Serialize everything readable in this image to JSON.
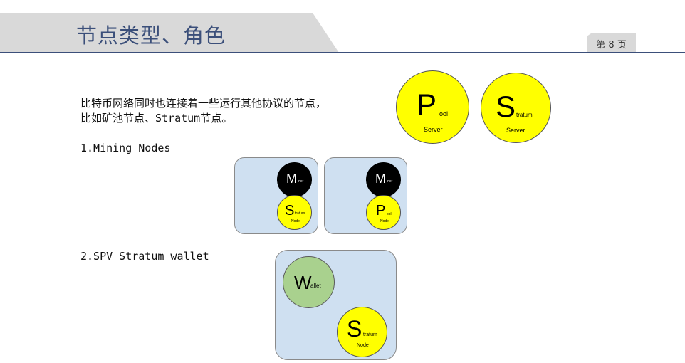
{
  "header": {
    "title": "节点类型、角色",
    "page_label": "第 8 页"
  },
  "body": {
    "intro_line1": "比特币网络同时也连接着一些运行其他协议的节点，",
    "intro_line2": "比如矿池节点、Stratum节点。",
    "item1": "1.Mining Nodes",
    "item2": "2.SPV Stratum wallet"
  },
  "diagram": {
    "pool_server": {
      "letter": "P",
      "sub": "ool",
      "caption": "Server"
    },
    "stratum_server": {
      "letter": "S",
      "sub": "tratum",
      "caption": "Server"
    },
    "miner_a": {
      "letter": "M",
      "sub": "iner"
    },
    "stratum_node_a": {
      "letter": "S",
      "sub": "tratum",
      "caption": "Node"
    },
    "miner_b": {
      "letter": "M",
      "sub": "iner"
    },
    "pool_node_b": {
      "letter": "P",
      "sub": "ool",
      "caption": "Node"
    },
    "wallet": {
      "letter": "W",
      "sub": "allet"
    },
    "stratum_node_c": {
      "letter": "S",
      "sub": "tratum",
      "caption": "Node"
    }
  },
  "colors": {
    "title": "#3b4f7a",
    "yellow": "#ffff00",
    "box": "#cfe0f1",
    "wallet": "#a9d18e"
  }
}
